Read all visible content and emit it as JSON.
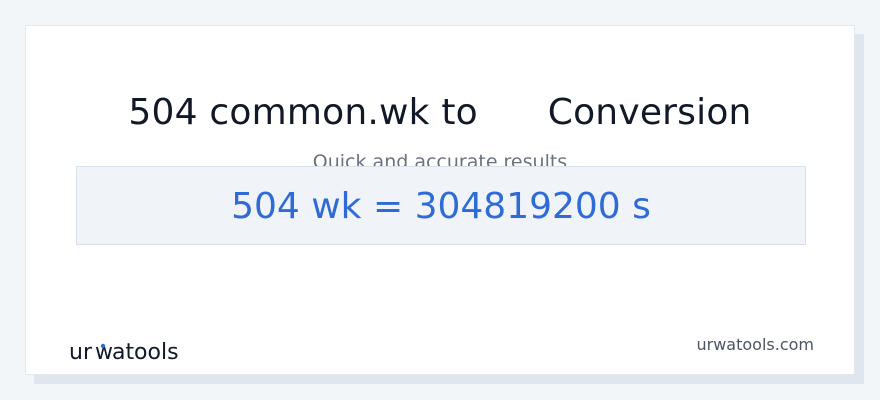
{
  "title": "504 common.wk to      Conversion",
  "subtitle": "Quick and accurate results",
  "result": "504 wk = 304819200 s",
  "logo_text": "urwatools",
  "site": "urwatools.com",
  "colors": {
    "accent": "#2f6bd8",
    "text": "#111827",
    "muted": "#6b7280"
  }
}
